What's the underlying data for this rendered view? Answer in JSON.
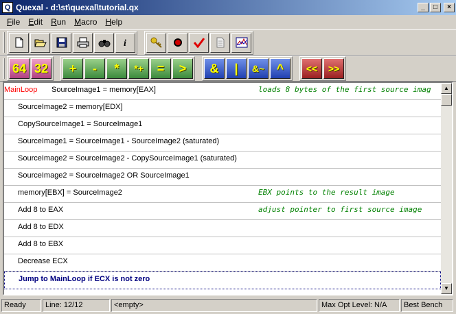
{
  "window": {
    "title": "Quexal - d:\\st\\quexal\\tutorial.qx",
    "controls": [
      "_",
      "□",
      "×"
    ]
  },
  "menu": [
    "File",
    "Edit",
    "Run",
    "Macro",
    "Help"
  ],
  "toolbar": {
    "file_group": [
      "new-icon",
      "open-icon",
      "save-icon",
      "print-icon",
      "find-icon",
      "info-icon"
    ],
    "run_group": [
      "key-icon",
      "record-icon",
      "check-icon",
      "page-icon",
      "chart-icon"
    ],
    "width_buttons": [
      "64",
      "32"
    ],
    "arith_buttons": [
      "+",
      "-",
      "*",
      "*+",
      "=",
      ">"
    ],
    "logic_buttons": [
      "&",
      "|",
      "&~",
      "^"
    ],
    "shift_buttons": [
      "<<",
      ">>"
    ]
  },
  "colors": {
    "label": "#ff0000",
    "comment": "#008000",
    "selected_text": "#000080",
    "title_bar": "#0a246a"
  },
  "code": [
    {
      "label": "MainLoop",
      "stmt": "SourceImage1 = memory[EAX]",
      "comment": "loads 8 bytes of the first source imag"
    },
    {
      "label": "",
      "stmt": "SourceImage2 = memory[EDX]",
      "comment": ""
    },
    {
      "label": "",
      "stmt": "CopySourceImage1 = SourceImage1",
      "comment": ""
    },
    {
      "label": "",
      "stmt": "SourceImage1 = SourceImage1 - SourceImage2 (saturated)",
      "comment": ""
    },
    {
      "label": "",
      "stmt": "SourceImage2 = SourceImage2 - CopySourceImage1 (saturated)",
      "comment": ""
    },
    {
      "label": "",
      "stmt": "SourceImage2 = SourceImage2 OR SourceImage1",
      "comment": ""
    },
    {
      "label": "",
      "stmt": "memory[EBX] = SourceImage2",
      "comment": "EBX points to the result image"
    },
    {
      "label": "",
      "stmt": "Add 8 to EAX",
      "comment": "adjust pointer to first source image"
    },
    {
      "label": "",
      "stmt": "Add 8 to EDX",
      "comment": ""
    },
    {
      "label": "",
      "stmt": "Add 8 to EBX",
      "comment": ""
    },
    {
      "label": "",
      "stmt": "Decrease ECX",
      "comment": ""
    },
    {
      "label": "",
      "stmt": "Jump to MainLoop if ECX is not zero",
      "comment": "",
      "selected": true
    }
  ],
  "status": {
    "state": "Ready",
    "line": "Line: 12/12",
    "info": "<empty>",
    "opt_level": "Max Opt Level: N/A",
    "bench": "Best Bench"
  }
}
